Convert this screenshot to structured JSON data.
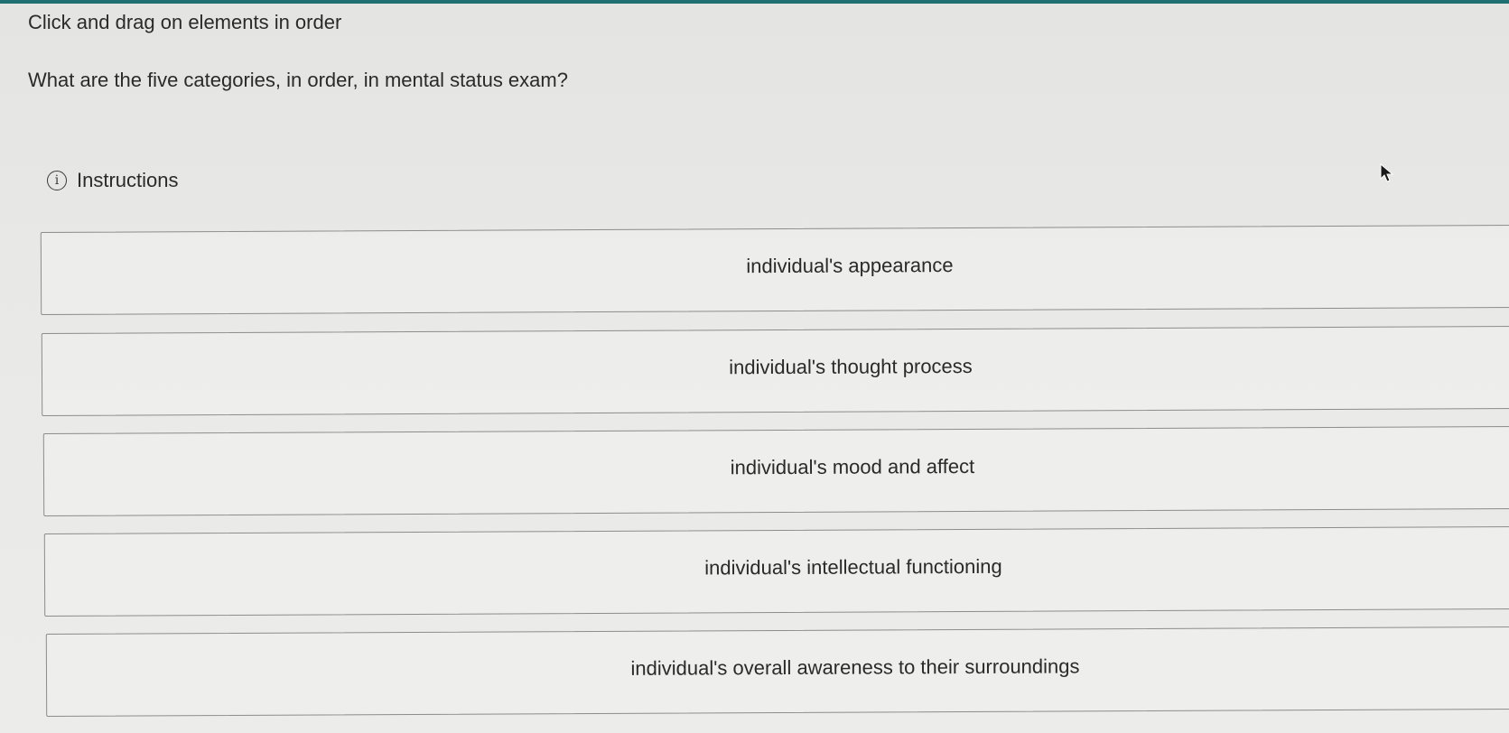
{
  "header": {
    "instruction": "Click and drag on elements in order",
    "question": "What are the five categories, in order, in mental status exam?"
  },
  "instructions_toggle": {
    "icon": "info-icon",
    "icon_glyph": "i",
    "label": "Instructions"
  },
  "accent_color": "#1f6f73",
  "items": [
    {
      "label": "individual's appearance"
    },
    {
      "label": "individual's thought process"
    },
    {
      "label": "individual's mood and affect"
    },
    {
      "label": "individual's intellectual functioning"
    },
    {
      "label": "individual's overall awareness to their surroundings"
    }
  ]
}
